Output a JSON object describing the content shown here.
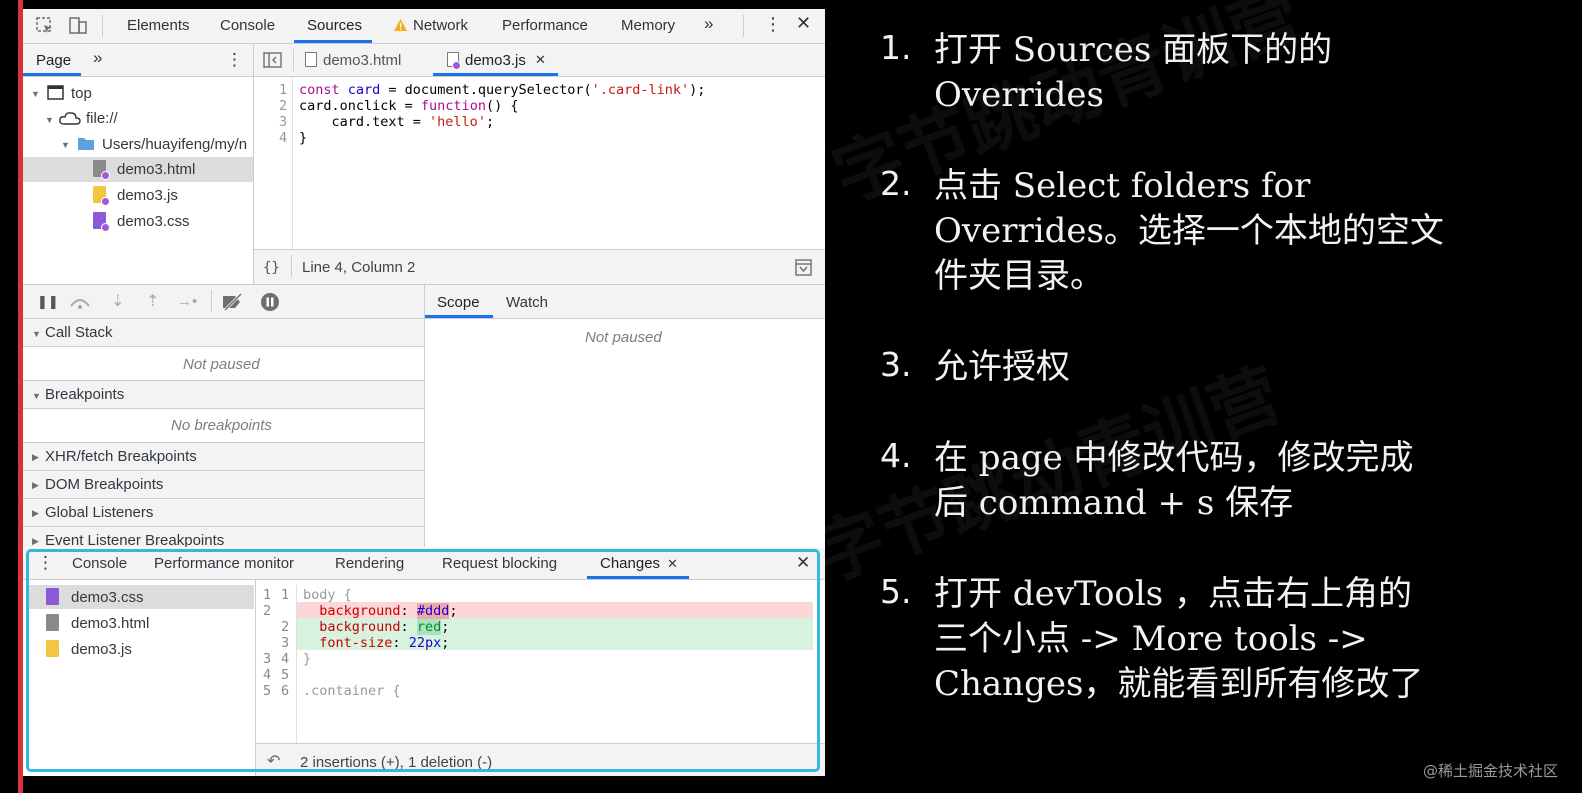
{
  "toolbar": {
    "tabs": [
      "Elements",
      "Console",
      "Sources",
      "Network",
      "Performance",
      "Memory"
    ]
  },
  "navigator": {
    "tab": "Page",
    "tree": {
      "top": "top",
      "origin": "file://",
      "folder": "Users/huayifeng/my/n",
      "files": [
        "demo3.html",
        "demo3.js",
        "demo3.css"
      ]
    }
  },
  "editor": {
    "tabs": [
      "demo3.html",
      "demo3.js"
    ],
    "line_numbers": [
      "1",
      "2",
      "3",
      "4"
    ],
    "status": "Line 4, Column 2"
  },
  "debugger": {
    "call_stack": "Call Stack",
    "not_paused": "Not paused",
    "breakpoints": "Breakpoints",
    "no_breakpoints": "No breakpoints",
    "xhr": "XHR/fetch Breakpoints",
    "dom": "DOM Breakpoints",
    "global": "Global Listeners",
    "event": "Event Listener Breakpoints",
    "scope_tabs": [
      "Scope",
      "Watch"
    ],
    "scope_not_paused": "Not paused"
  },
  "drawer": {
    "tabs": [
      "Console",
      "Performance monitor",
      "Rendering",
      "Request blocking",
      "Changes"
    ],
    "files": [
      "demo3.css",
      "demo3.html",
      "demo3.js"
    ],
    "left_nums": [
      "1",
      "2",
      "",
      "",
      "3",
      "4",
      "5"
    ],
    "right_nums": [
      "1",
      "",
      "2",
      "3",
      "4",
      "5",
      "6"
    ],
    "summary": "2 insertions (+), 1 deletion (-)"
  },
  "slide": {
    "items": [
      {
        "num": "1.",
        "text": "打开 Sources 面板下的的\nOverrides"
      },
      {
        "num": "2.",
        "text": "点击 Select folders for\nOverrides。选择一个本地的空文\n件夹目录。"
      },
      {
        "num": "3.",
        "text": "允许授权"
      },
      {
        "num": "4.",
        "text": "在 page 中修改代码，修改完成\n后 command + s 保存"
      },
      {
        "num": "5.",
        "text": "打开 devTools ，点击右上角的\n三个小点 -> More tools ->\nChanges，就能看到所有修改了"
      }
    ],
    "watermark": "@稀土掘金技术社区"
  },
  "colors": {
    "accent_blue": "#1a73e8",
    "highlight_cyan": "#35b8e0",
    "deletion_bg": "#fbd7d7",
    "insertion_bg": "#d8f2e0"
  }
}
